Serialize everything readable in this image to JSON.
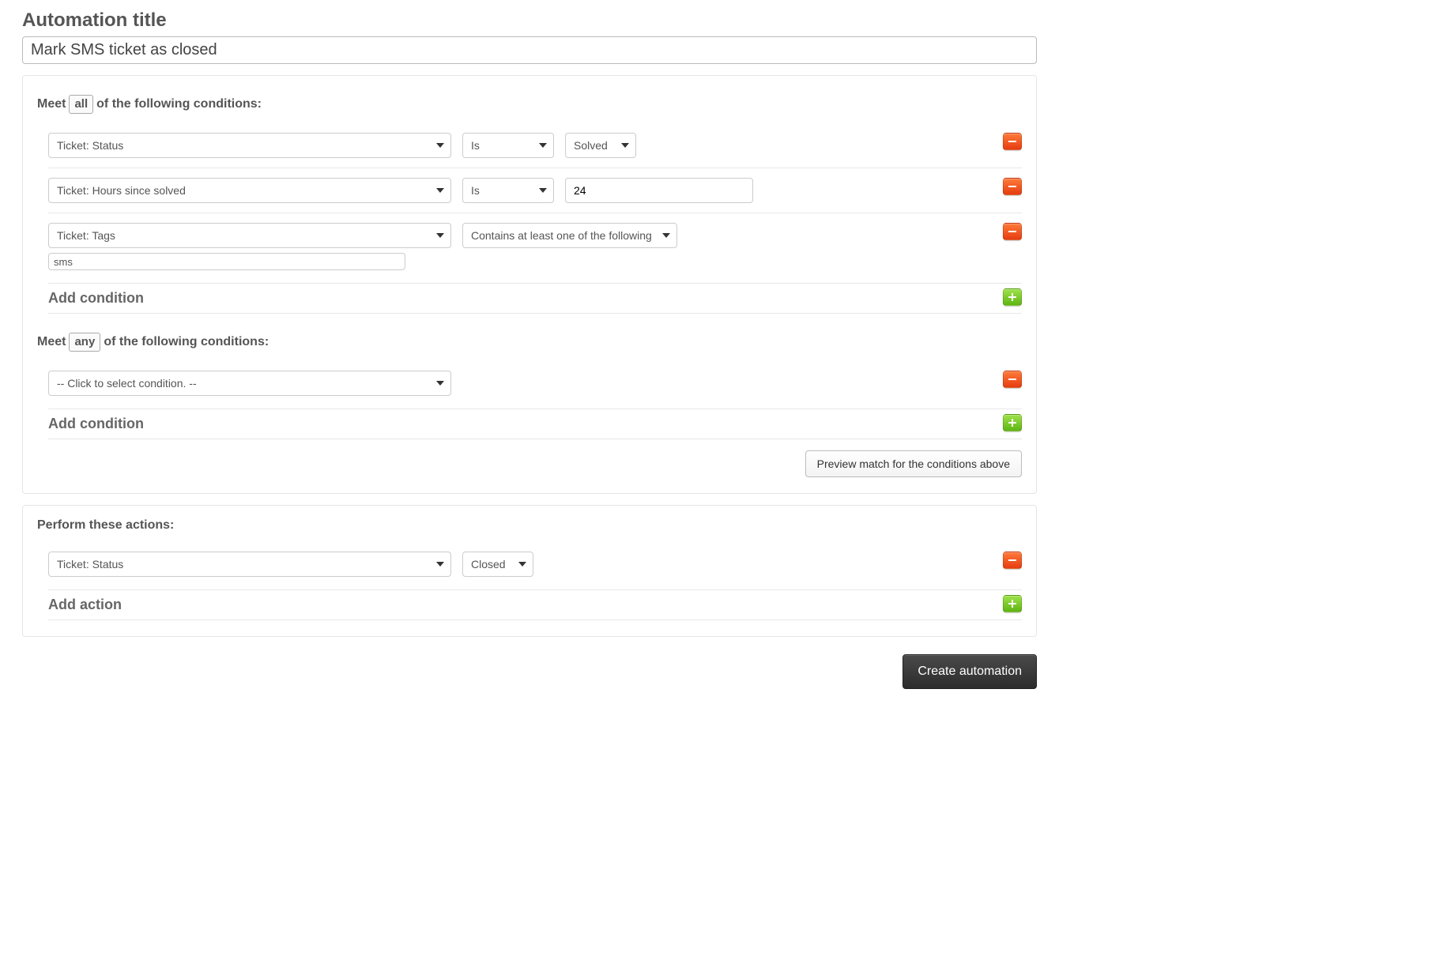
{
  "title": {
    "label": "Automation title",
    "value": "Mark SMS ticket as closed"
  },
  "all_conditions": {
    "prefix": "Meet",
    "token": "all",
    "suffix": "of the following conditions:",
    "rows": [
      {
        "field": "Ticket: Status",
        "operator": "Is",
        "value": "Solved",
        "value_type": "select"
      },
      {
        "field": "Ticket: Hours since solved",
        "operator": "Is",
        "value": "24",
        "value_type": "text"
      },
      {
        "field": "Ticket: Tags",
        "operator": "Contains at least one of the following",
        "tags": "sms",
        "value_type": "tags"
      }
    ],
    "add_label": "Add condition"
  },
  "any_conditions": {
    "prefix": "Meet",
    "token": "any",
    "suffix": "of the following conditions:",
    "rows": [
      {
        "field": "-- Click to select condition. --"
      }
    ],
    "add_label": "Add condition"
  },
  "preview_button": "Preview match for the conditions above",
  "actions": {
    "label": "Perform these actions:",
    "rows": [
      {
        "field": "Ticket: Status",
        "value": "Closed"
      }
    ],
    "add_label": "Add action"
  },
  "create_button": "Create automation"
}
